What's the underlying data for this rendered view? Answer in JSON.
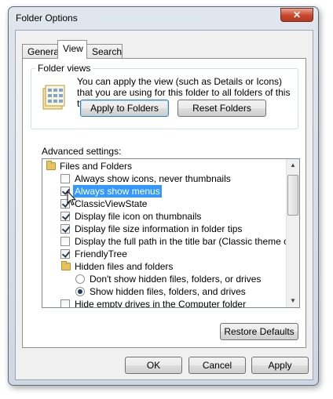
{
  "window": {
    "title": "Folder Options",
    "close_glyph": "✕"
  },
  "tabs": [
    {
      "label": "General",
      "active": false
    },
    {
      "label": "View",
      "active": true
    },
    {
      "label": "Search",
      "active": false
    }
  ],
  "folder_views": {
    "label": "Folder views",
    "text": "You can apply the view (such as Details or Icons) that you are using for this folder to all folders of this type.",
    "apply_label": "Apply to Folders",
    "reset_label": "Reset Folders",
    "icon": "folder-views-icon"
  },
  "advanced": {
    "label": "Advanced settings:",
    "items": [
      {
        "type": "folder",
        "label": "Files and Folders",
        "indent": 0
      },
      {
        "type": "checkbox",
        "label": "Always show icons, never thumbnails",
        "checked": false
      },
      {
        "type": "checkbox",
        "label": "Always show menus",
        "checked": true,
        "selected": true
      },
      {
        "type": "checkbox",
        "label": "ClassicViewState",
        "checked": true
      },
      {
        "type": "checkbox",
        "label": "Display file icon on thumbnails",
        "checked": true
      },
      {
        "type": "checkbox",
        "label": "Display file size information in folder tips",
        "checked": true
      },
      {
        "type": "checkbox",
        "label": "Display the full path in the title bar (Classic theme only)",
        "checked": false
      },
      {
        "type": "checkbox",
        "label": "FriendlyTree",
        "checked": true
      },
      {
        "type": "folder",
        "label": "Hidden files and folders",
        "indent": 1
      },
      {
        "type": "radio",
        "label": "Don't show hidden files, folders, or drives",
        "checked": false
      },
      {
        "type": "radio",
        "label": "Show hidden files, folders, and drives",
        "checked": true
      },
      {
        "type": "checkbox",
        "label": "Hide empty drives in the Computer folder",
        "checked": false
      }
    ],
    "restore_label": "Restore Defaults"
  },
  "footer": {
    "ok_label": "OK",
    "cancel_label": "Cancel",
    "apply_label": "Apply"
  },
  "colors": {
    "selection": "#3399ff",
    "close_button": "#c8462c"
  }
}
